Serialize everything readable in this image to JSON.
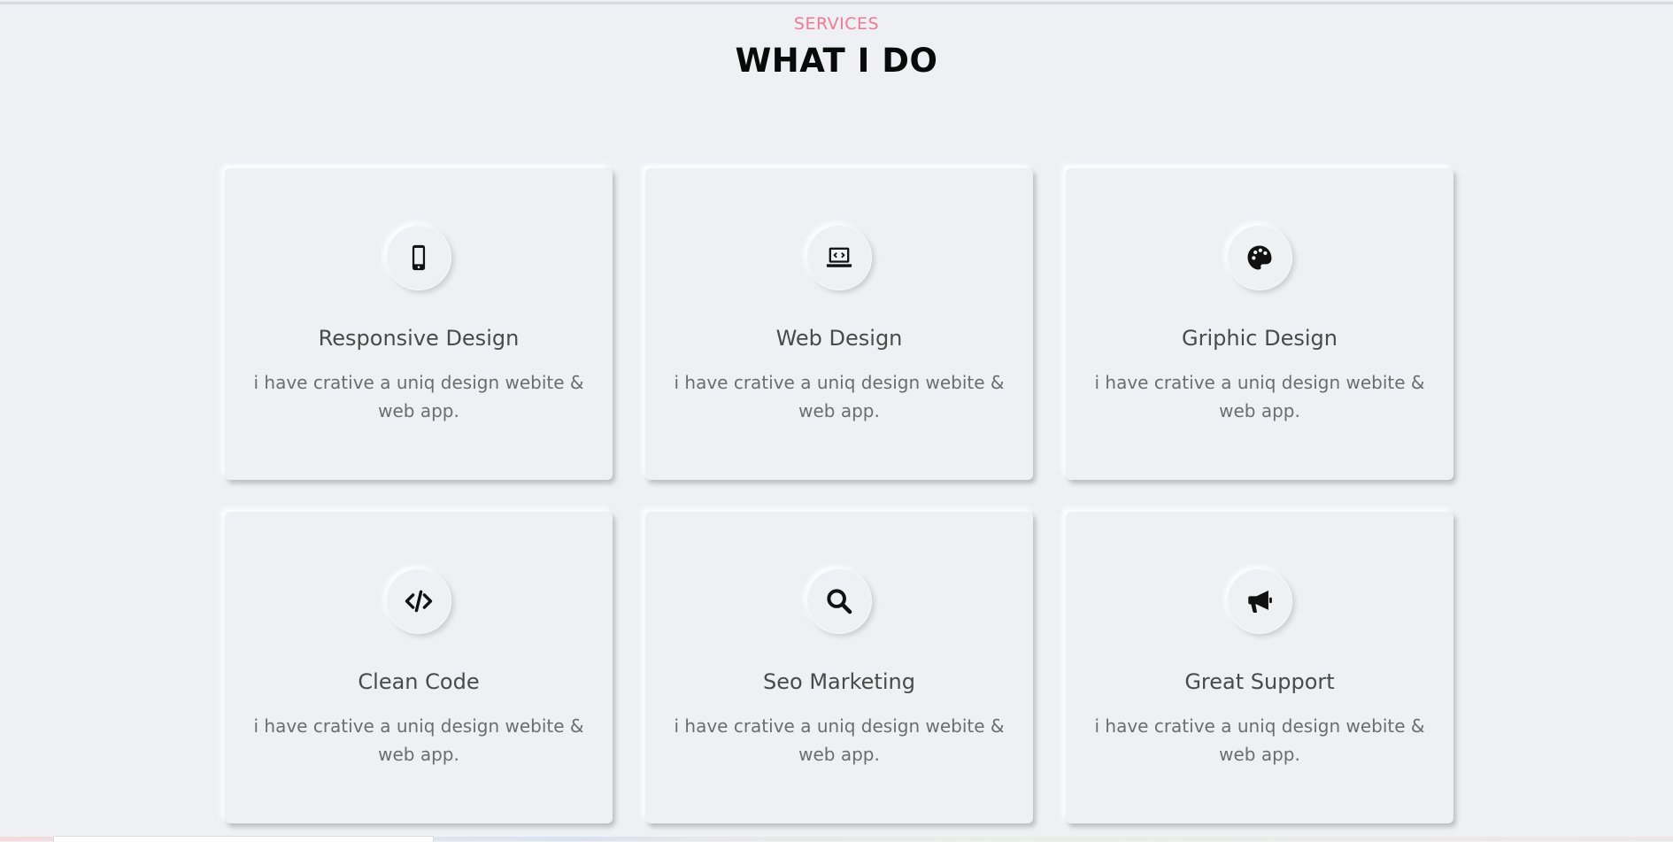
{
  "header": {
    "eyebrow": "SERVICES",
    "title": "WHAT I DO"
  },
  "colors": {
    "accent": "#f07a93",
    "background": "#eef0f4",
    "heading": "#0a0a0a",
    "card_title": "#4a4a4a",
    "card_text": "#6d6d6d"
  },
  "services": [
    {
      "title": "Responsive Design",
      "description": "i have crative a uniq design webite & web app.",
      "icon": "mobile-phone-icon"
    },
    {
      "title": "Web Design",
      "description": "i have crative a uniq design webite & web app.",
      "icon": "laptop-code-icon"
    },
    {
      "title": "Griphic Design",
      "description": "i have crative a uniq design webite & web app.",
      "icon": "palette-icon"
    },
    {
      "title": "Clean Code",
      "description": "i have crative a uniq design webite & web app.",
      "icon": "code-icon"
    },
    {
      "title": "Seo Marketing",
      "description": "i have crative a uniq design webite & web app.",
      "icon": "search-icon"
    },
    {
      "title": "Great Support",
      "description": "i have crative a uniq design webite & web app.",
      "icon": "megaphone-icon"
    }
  ]
}
